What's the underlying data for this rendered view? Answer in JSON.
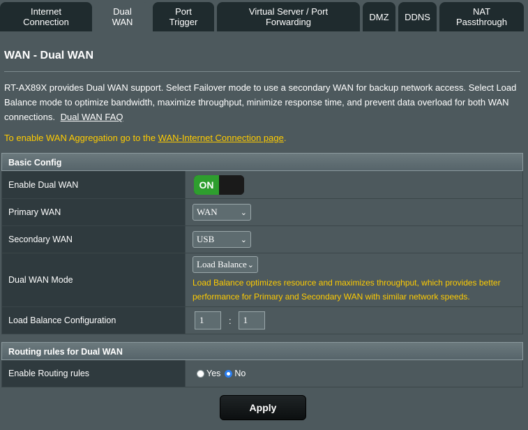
{
  "tabs": [
    {
      "label": "Internet\nConnection"
    },
    {
      "label": "Dual\nWAN"
    },
    {
      "label": "Port\nTrigger"
    },
    {
      "label": "Virtual Server / Port\nForwarding"
    },
    {
      "label": "DMZ"
    },
    {
      "label": "DDNS"
    },
    {
      "label": "NAT\nPassthrough"
    }
  ],
  "page": {
    "title": "WAN - Dual WAN",
    "description": "RT-AX89X provides Dual WAN support. Select Failover mode to use a secondary WAN for backup network access. Select Load Balance mode to optimize bandwidth, maximize throughput, minimize response time, and prevent data overload for both WAN connections.",
    "faq_link": "Dual WAN FAQ",
    "note_prefix": "To enable WAN Aggregation go to the ",
    "note_link": "WAN-Internet Connection page",
    "note_suffix": "."
  },
  "basic_config": {
    "header": "Basic Config",
    "enable_label": "Enable Dual WAN",
    "enable_state": "ON",
    "primary_label": "Primary WAN",
    "primary_value": "WAN",
    "secondary_label": "Secondary WAN",
    "secondary_value": "USB",
    "mode_label": "Dual WAN Mode",
    "mode_value": "Load Balance",
    "mode_desc": "Load Balance optimizes resource and maximizes throughput, which provides better performance for Primary and Secondary WAN with similar network speeds.",
    "lb_label": "Load Balance Configuration",
    "lb_primary": "1",
    "lb_sep": ":",
    "lb_secondary": "1"
  },
  "routing": {
    "header": "Routing rules for Dual WAN",
    "enable_label": "Enable Routing rules",
    "yes_label": "Yes",
    "no_label": "No",
    "selected": "No"
  },
  "apply_label": "Apply",
  "colors": {
    "background": "#4d595d",
    "note": "#ffcc00",
    "toggle_on": "#2e9e2e",
    "tab_inactive": "#1f2b2e"
  }
}
